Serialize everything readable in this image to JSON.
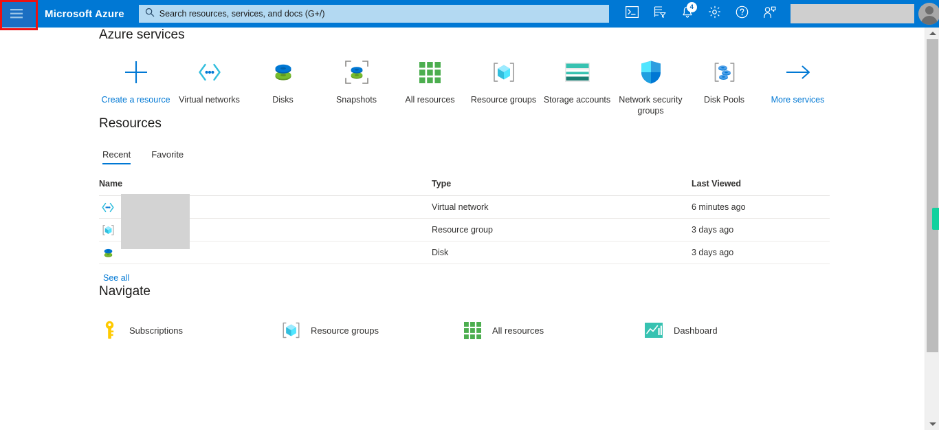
{
  "header": {
    "menu_icon": "hamburger-icon",
    "brand": "Microsoft Azure",
    "search": {
      "icon": "search-icon",
      "placeholder": "Search resources, services, and docs (G+/)",
      "value": ""
    },
    "icons": [
      {
        "name": "cloud-shell-icon",
        "label": "Cloud Shell"
      },
      {
        "name": "directories-subscriptions-icon",
        "label": "Directories + subscriptions"
      },
      {
        "name": "notifications-bell-icon",
        "label": "Notifications",
        "badge": "4"
      },
      {
        "name": "settings-gear-icon",
        "label": "Settings"
      },
      {
        "name": "help-question-icon",
        "label": "Help"
      },
      {
        "name": "feedback-person-icon",
        "label": "Feedback"
      }
    ],
    "account_redacted": "",
    "avatar": "user-avatar"
  },
  "azure_services": {
    "title": "Azure services",
    "items": [
      {
        "label": "Create a resource",
        "icon": "plus-icon",
        "link": true
      },
      {
        "label": "Virtual networks",
        "icon": "virtual-network-icon",
        "link": false
      },
      {
        "label": "Disks",
        "icon": "disks-icon",
        "link": false
      },
      {
        "label": "Snapshots",
        "icon": "snapshots-icon",
        "link": false
      },
      {
        "label": "All resources",
        "icon": "all-resources-grid-icon",
        "link": false
      },
      {
        "label": "Resource groups",
        "icon": "resource-group-icon",
        "link": false
      },
      {
        "label": "Storage accounts",
        "icon": "storage-account-icon",
        "link": false
      },
      {
        "label": "Network security groups",
        "icon": "network-security-group-shield-icon",
        "link": false
      },
      {
        "label": "Disk Pools",
        "icon": "disk-pools-icon",
        "link": false
      },
      {
        "label": "More services",
        "icon": "arrow-right-icon",
        "link": true
      }
    ]
  },
  "resources": {
    "title": "Resources",
    "tabs": [
      {
        "label": "Recent",
        "active": true
      },
      {
        "label": "Favorite",
        "active": false
      }
    ],
    "columns": [
      "Name",
      "Type",
      "Last Viewed"
    ],
    "rows": [
      {
        "icon": "virtual-network-icon",
        "name": "",
        "type": "Virtual network",
        "last_viewed": "6 minutes ago"
      },
      {
        "icon": "resource-group-icon",
        "name": "",
        "type": "Resource group",
        "last_viewed": "3 days ago"
      },
      {
        "icon": "disks-icon",
        "name": "",
        "type": "Disk",
        "last_viewed": "3 days ago"
      }
    ],
    "see_all": "See all"
  },
  "navigate": {
    "title": "Navigate",
    "items": [
      {
        "label": "Subscriptions",
        "icon": "subscriptions-key-icon"
      },
      {
        "label": "Resource groups",
        "icon": "resource-group-icon"
      },
      {
        "label": "All resources",
        "icon": "all-resources-grid-icon"
      },
      {
        "label": "Dashboard",
        "icon": "dashboard-chart-icon"
      }
    ]
  },
  "scrollbar": {
    "up_icon": "scroll-up-arrow-icon",
    "down_icon": "scroll-down-arrow-icon",
    "find_marker": "find-match-marker"
  },
  "colors": {
    "azure_blue": "#0078d4",
    "header_hover": "#1b6ec2",
    "search_bg": "#b3d9f2",
    "link": "#0078d4",
    "highlight_box": "#ee1111",
    "find_marker": "#12d19e",
    "redacted": "#d3d3d3"
  }
}
